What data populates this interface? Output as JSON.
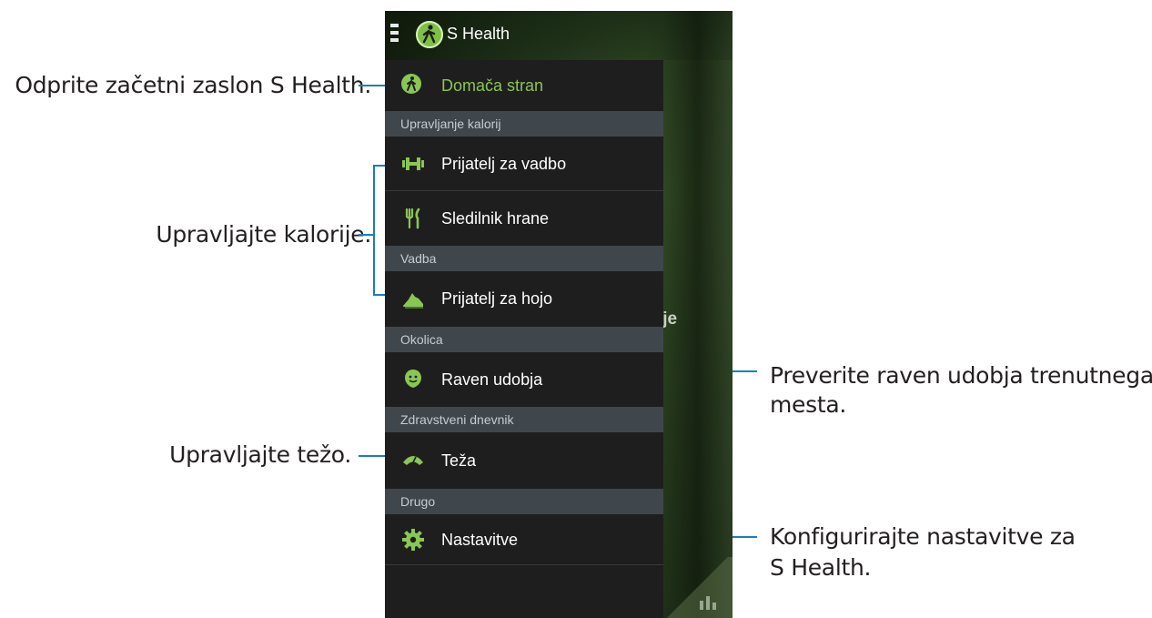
{
  "app": {
    "title": "S Health",
    "background_label": "ije"
  },
  "drawer": {
    "home": "Domača stran",
    "sections": {
      "calories": "Upravljanje kalorij",
      "exercise": "Vadba",
      "environment": "Okolica",
      "health_diary": "Zdravstveni dnevnik",
      "other": "Drugo"
    },
    "items": {
      "exercise_mate": "Prijatelj za vadbo",
      "food_tracker": "Sledilnik hrane",
      "walking_mate": "Prijatelj za hojo",
      "comfort_level": "Raven udobja",
      "weight": "Teža",
      "settings": "Nastavitve"
    }
  },
  "annotations": {
    "home": "Odprite začetni zaslon S Health.",
    "calories": "Upravljajte kalorije.",
    "comfort_line1": "Preverite raven udobja trenutnega",
    "comfort_line2": "mesta.",
    "weight": "Upravljajte težo.",
    "settings_line1": "Konfigurirajte nastavitve za",
    "settings_line2": "S Health."
  },
  "colors": {
    "accent_green": "#8ac653",
    "callout_line": "#1a7fb7",
    "drawer_bg": "#1e1e1e",
    "section_bg": "#3f474d"
  },
  "icons": {
    "menu": "hamburger-icon",
    "logo": "walking-person-icon",
    "exercise": "dumbbell-icon",
    "food": "fork-knife-icon",
    "walking": "shoe-icon",
    "comfort": "smiley-leaf-icon",
    "weight": "scale-icon",
    "settings": "gear-icon",
    "chart": "bar-chart-icon"
  }
}
